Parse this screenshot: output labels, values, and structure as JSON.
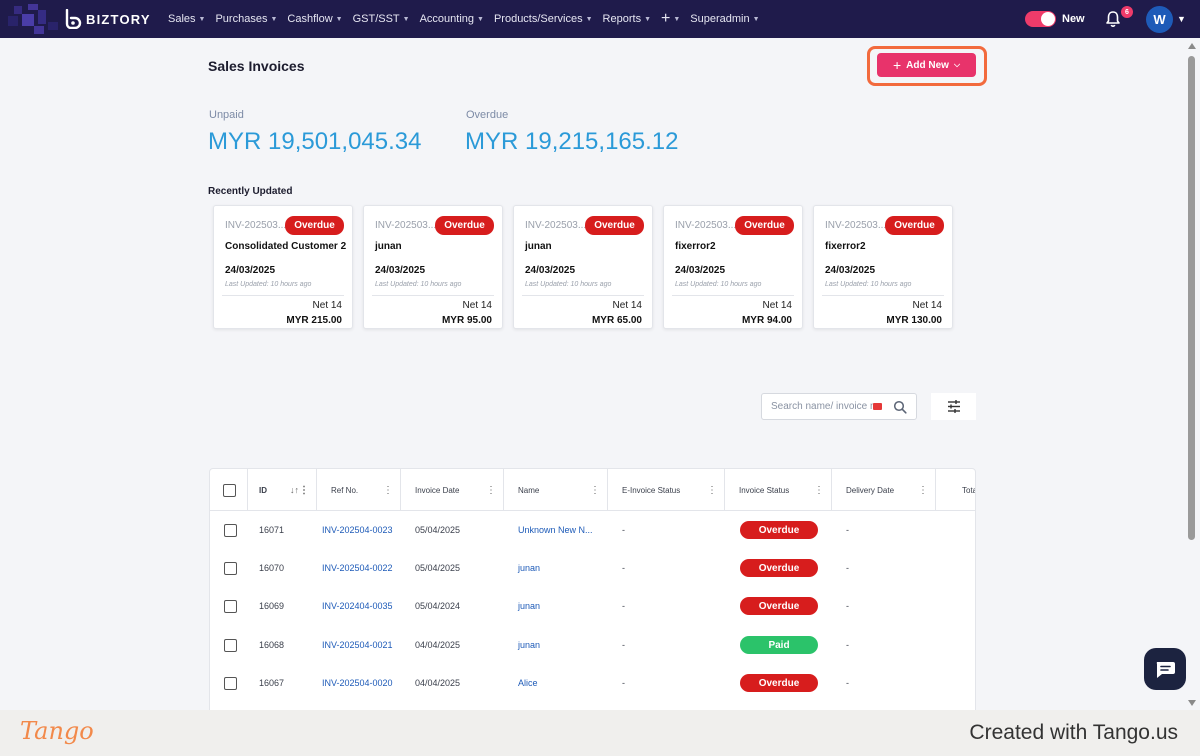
{
  "nav": {
    "brand": "BIZTORY",
    "items": [
      "Sales",
      "Purchases",
      "Cashflow",
      "GST/SST",
      "Accounting",
      "Products/Services",
      "Reports",
      "+",
      "Superadmin"
    ],
    "toggle_label": "New",
    "notification_count": "6",
    "avatar_initial": "W"
  },
  "page": {
    "title": "Sales Invoices",
    "add_new_label": "Add New"
  },
  "summary": {
    "unpaid_label": "Unpaid",
    "unpaid_value": "MYR 19,501,045.34",
    "overdue_label": "Overdue",
    "overdue_value": "MYR 19,215,165.12"
  },
  "recent": {
    "title": "Recently Updated",
    "cards": [
      {
        "inv": "INV-202503...",
        "status": "Overdue",
        "name": "Consolidated Customer 2",
        "date": "24/03/2025",
        "updated": "Last Updated: 10 hours ago",
        "term": "Net 14",
        "amount": "MYR 215.00"
      },
      {
        "inv": "INV-202503...",
        "status": "Overdue",
        "name": "junan",
        "date": "24/03/2025",
        "updated": "Last Updated: 10 hours ago",
        "term": "Net 14",
        "amount": "MYR 95.00"
      },
      {
        "inv": "INV-202503...",
        "status": "Overdue",
        "name": "junan",
        "date": "24/03/2025",
        "updated": "Last Updated: 10 hours ago",
        "term": "Net 14",
        "amount": "MYR 65.00"
      },
      {
        "inv": "INV-202503...",
        "status": "Overdue",
        "name": "fixerror2",
        "date": "24/03/2025",
        "updated": "Last Updated: 10 hours ago",
        "term": "Net 14",
        "amount": "MYR 94.00"
      },
      {
        "inv": "INV-202503...",
        "status": "Overdue",
        "name": "fixerror2",
        "date": "24/03/2025",
        "updated": "Last Updated: 10 hours ago",
        "term": "Net 14",
        "amount": "MYR 130.00"
      }
    ]
  },
  "search": {
    "placeholder": "Search name/ invoice no."
  },
  "table": {
    "columns": [
      "ID",
      "Ref No.",
      "Invoice Date",
      "Name",
      "E-Invoice Status",
      "Invoice Status",
      "Delivery Date",
      "Tota"
    ],
    "rows": [
      {
        "id": "16071",
        "ref": "INV-202504-0023",
        "date": "05/04/2025",
        "name": "Unknown New N...",
        "einvoice": "-",
        "status": "Overdue",
        "delivery": "-"
      },
      {
        "id": "16070",
        "ref": "INV-202504-0022",
        "date": "05/04/2025",
        "name": "junan",
        "einvoice": "-",
        "status": "Overdue",
        "delivery": "-"
      },
      {
        "id": "16069",
        "ref": "INV-202404-0035",
        "date": "05/04/2024",
        "name": "junan",
        "einvoice": "-",
        "status": "Overdue",
        "delivery": "-"
      },
      {
        "id": "16068",
        "ref": "INV-202504-0021",
        "date": "04/04/2025",
        "name": "junan",
        "einvoice": "-",
        "status": "Paid",
        "delivery": "-"
      },
      {
        "id": "16067",
        "ref": "INV-202504-0020",
        "date": "04/04/2025",
        "name": "Alice",
        "einvoice": "-",
        "status": "Overdue",
        "delivery": "-"
      }
    ]
  },
  "footer": {
    "logo": "Tango",
    "created_text": "Created with Tango.us"
  },
  "colors": {
    "topbar": "#1f1b4b",
    "accent": "#e8336b",
    "highlight": "#f26a3d",
    "overdue": "#d71d1d",
    "paid": "#2bc36a",
    "amount": "#2b9ad8"
  },
  "icons": [
    "logo-icon",
    "bell-icon",
    "search-icon",
    "flag-icon",
    "filter-icon",
    "chat-icon",
    "sort-icon",
    "column-menu-icon"
  ]
}
